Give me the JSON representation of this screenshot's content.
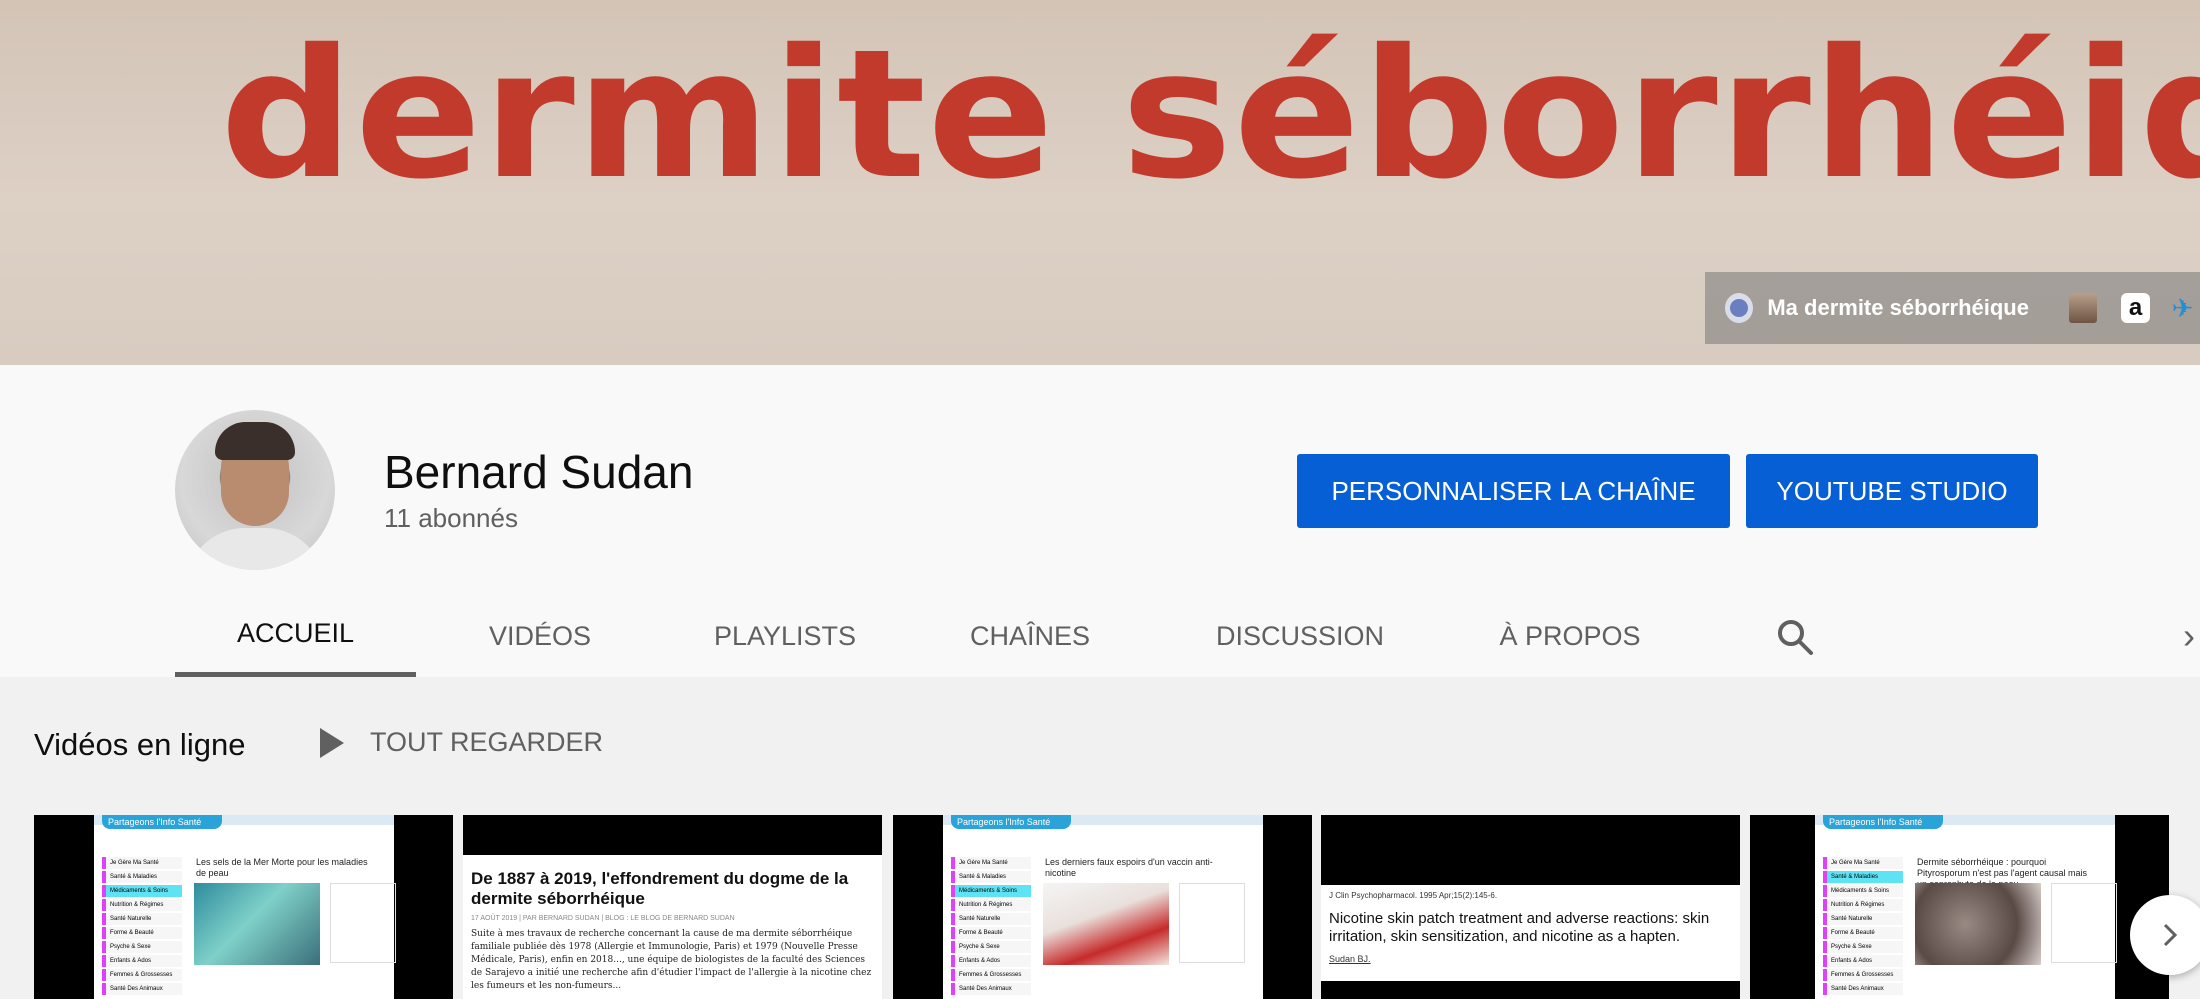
{
  "banner": {
    "text": "dermite séborrhéique",
    "link_label": "Ma dermite séborrhéique",
    "link_icons": [
      "globe-icon",
      "avatar-icon",
      "amazon-icon",
      "extra-icon"
    ],
    "amazon_glyph": "a"
  },
  "channel": {
    "name": "Bernard Sudan",
    "subscribers": "11 abonnés",
    "customize_label": "PERSONNALISER LA CHAÎNE",
    "studio_label": "YOUTUBE STUDIO"
  },
  "tabs": [
    {
      "label": "ACCUEIL",
      "active": true
    },
    {
      "label": "VIDÉOS",
      "active": false
    },
    {
      "label": "PLAYLISTS",
      "active": false
    },
    {
      "label": "CHAÎNES",
      "active": false
    },
    {
      "label": "DISCUSSION",
      "active": false
    },
    {
      "label": "À PROPOS",
      "active": false
    }
  ],
  "shelf": {
    "title": "Vidéos en ligne",
    "play_all_label": "TOUT REGARDER"
  },
  "videos": [
    {
      "site_tag": "Partageons l'Info Santé",
      "post_title": "Les sels de la Mer Morte pour les maladies de peau",
      "nav_items": [
        "Je Gère Ma Santé",
        "Santé & Maladies",
        "Médicaments & Soins",
        "Nutrition & Régimes",
        "Santé Naturelle",
        "Forme & Beauté",
        "Psyche & Sexe",
        "Enfants & Ados",
        "Femmes & Grossesses",
        "Santé Des Animaux"
      ]
    },
    {
      "title": "De 1887 à 2019, l'effondrement du dogme de la dermite séborrhéique",
      "meta": "17 AOÛT 2019 | PAR BERNARD SUDAN | BLOG : LE BLOG DE BERNARD SUDAN",
      "body": "Suite à mes travaux de recherche concernant la cause de ma dermite séborrhéique familiale publiée dès 1978 (Allergie et Immunologie, Paris) et 1979 (Nouvelle Presse Médicale, Paris), enfin en 2018..., une équipe de biologistes de la faculté des Sciences de Sarajevo a initié une recherche afin d'étudier l'impact de l'allergie à la nicotine chez les fumeurs et les non-fumeurs..."
    },
    {
      "site_tag": "Partageons l'Info Santé",
      "post_title": "Les derniers faux espoirs d'un vaccin anti-nicotine",
      "nav_items": [
        "Je Gère Ma Santé",
        "Santé & Maladies",
        "Médicaments & Soins",
        "Nutrition & Régimes",
        "Santé Naturelle",
        "Forme & Beauté",
        "Psyche & Sexe",
        "Enfants & Ados",
        "Femmes & Grossesses",
        "Santé Des Animaux"
      ]
    },
    {
      "ref": "J Clin Psychopharmacol. 1995 Apr;15(2):145-6.",
      "title": "Nicotine skin patch treatment and adverse reactions: skin irritation, skin sensitization, and nicotine as a hapten.",
      "author": "Sudan BJ."
    },
    {
      "site_tag": "Partageons l'Info Santé",
      "post_title": "Dermite séborrhéique : pourquoi Pityrosporum n'est pas l'agent causal mais un saprophyte de la peau.",
      "nav_items": [
        "Je Gère Ma Santé",
        "Santé & Maladies",
        "Médicaments & Soins",
        "Nutrition & Régimes",
        "Santé Naturelle",
        "Forme & Beauté",
        "Psyche & Sexe",
        "Enfants & Ados",
        "Femmes & Grossesses",
        "Santé Des Animaux"
      ]
    }
  ],
  "colors": {
    "accent_blue": "#065fd4",
    "banner_red": "#c23a2c",
    "site_blue": "#29a3d8"
  }
}
